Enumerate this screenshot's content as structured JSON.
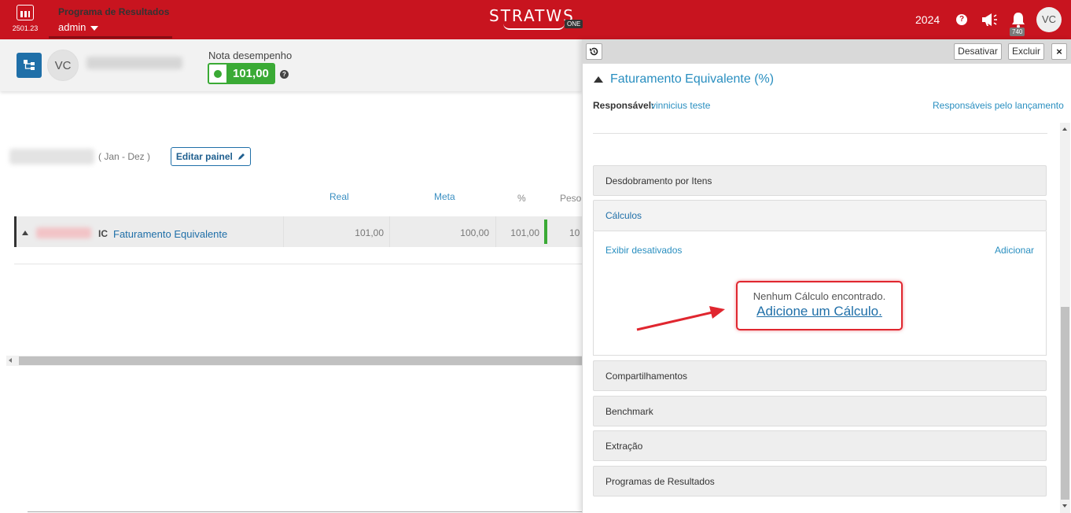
{
  "topbar": {
    "version": "2501.23",
    "program_title": "Programa de Resultados",
    "user": "admin",
    "logo_text": "STRATWS",
    "logo_badge": "ONE",
    "year": "2024",
    "help_glyph": "?",
    "notifications_count": "740",
    "avatar_initials": "VC",
    "colors": {
      "brand": "#c8141f"
    }
  },
  "subheader": {
    "avatar_initials": "VC",
    "nota_label": "Nota desempenho",
    "nota_value": "101,00",
    "nota_status_color": "#3aaa35"
  },
  "main": {
    "period": "( Jan - Dez )",
    "edit_button": "Editar painel",
    "columns": {
      "real": "Real",
      "meta": "Meta",
      "pct": "%",
      "peso": "Peso"
    },
    "row": {
      "type": "IC",
      "name": "Faturamento Equivalente",
      "real": "101,00",
      "meta": "100,00",
      "pct": "101,00",
      "peso": "10"
    }
  },
  "panel": {
    "actions": {
      "deactivate": "Desativar",
      "delete": "Excluir",
      "close": "×"
    },
    "title": "Faturamento Equivalente (%)",
    "responsavel_label": "Responsável:",
    "responsavel_value": "vinnicius teste",
    "responsaveis_link": "Responsáveis pelo lançamento",
    "sections": [
      "Desdobramento por Itens",
      "Cálculos",
      "Compartilhamentos",
      "Benchmark",
      "Extração",
      "Programas de Resultados"
    ],
    "calculos": {
      "show_disabled": "Exibir desativados",
      "add": "Adicionar",
      "empty_text": "Nenhum Cálculo encontrado.",
      "empty_link": "Adicione um Cálculo."
    },
    "annotation_color": "#e0262f"
  }
}
